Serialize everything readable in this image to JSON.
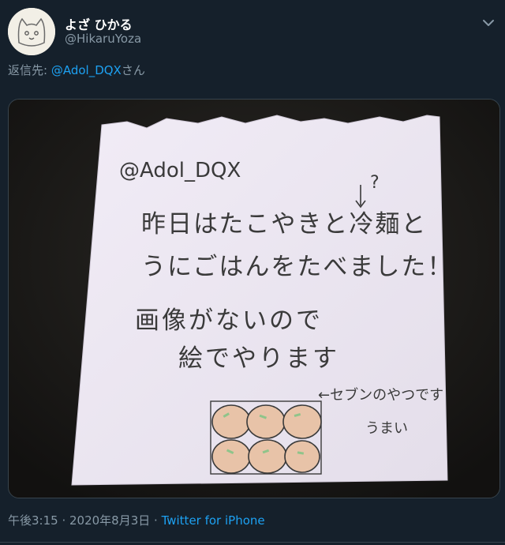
{
  "user": {
    "display_name": "よざ ひかる",
    "handle": "@HikaruYoza"
  },
  "reply": {
    "prefix": "返信先: ",
    "mention": "@Adol_DQX",
    "suffix": "さん"
  },
  "note": {
    "line1": "@Adol_DQX",
    "question_mark": "?",
    "line2": "昨日はたこやきと冷麺と",
    "line3": "うにごはんをたべました！",
    "line4": "画像がないので",
    "line5": "絵でやります",
    "side_note_1": "←セブンのやつです",
    "side_note_2": "うまい"
  },
  "meta": {
    "time_date": "午後3:15 · 2020年8月3日 · ",
    "source": "Twitter for iPhone"
  },
  "icons": [
    "cat-avatar-icon",
    "more-options-icon"
  ],
  "colors": {
    "background": "#15202b",
    "secondary_text": "#8899a6",
    "link": "#1da1f2"
  }
}
